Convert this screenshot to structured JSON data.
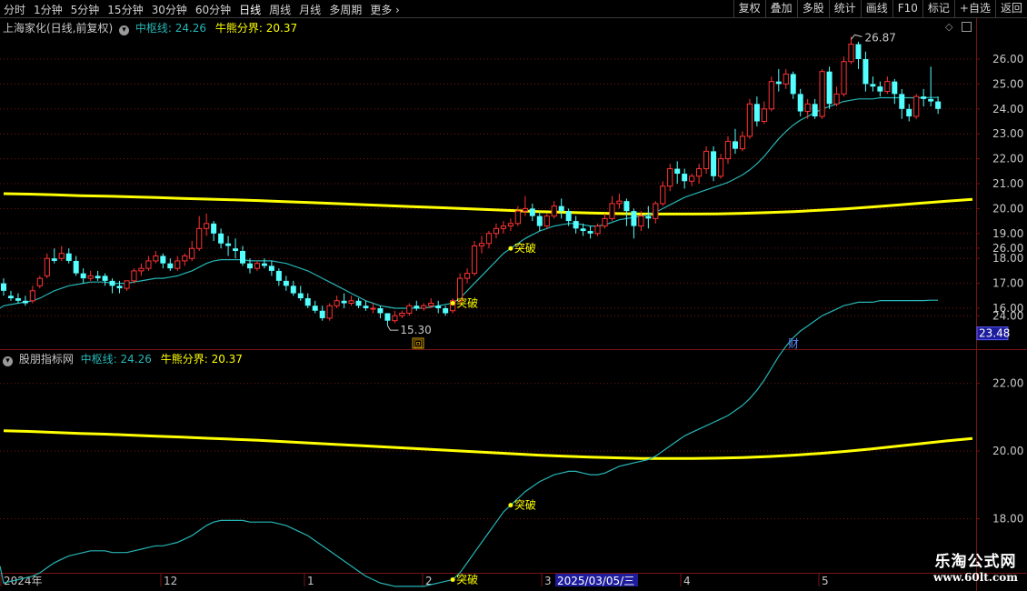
{
  "toolbar": {
    "periods": [
      "分时",
      "1分钟",
      "5分钟",
      "15分钟",
      "30分钟",
      "60分钟",
      "日线",
      "周线",
      "月线",
      "多周期"
    ],
    "active_period": "日线",
    "more": "更多",
    "right_buttons": [
      "复权",
      "叠加",
      "多股",
      "统计",
      "画线",
      "F10",
      "标记",
      "+自选",
      "返回"
    ]
  },
  "main_panel": {
    "title": "上海家化(日线,前复权)",
    "ind1_label": "中枢线: 24.26",
    "ind2_label": "牛熊分界: 20.37",
    "high_label": "26.87",
    "low_label": "15.30",
    "signal_label": "突破",
    "marker_hui": "回",
    "marker_cai": "财"
  },
  "sub_panel": {
    "title": "股朋指标网",
    "ind1_label": "中枢线: 24.26",
    "ind2_label": "牛熊分界: 20.37",
    "current_value": "23.48",
    "signal_label": "突破"
  },
  "time_axis": {
    "labels": [
      "2024年",
      "12",
      "1",
      "2",
      "3",
      "4",
      "5"
    ],
    "cursor_date": "2025/03/05/三"
  },
  "colors": {
    "up": "#ff3232",
    "down": "#54ffff",
    "mid_line": "#27b5b5",
    "bull_bear": "#ffff00",
    "signal": "#ffff00",
    "grid": "#7a1414",
    "axis_text": "#c8c8c8"
  },
  "watermark": {
    "line1": "乐淘公式网",
    "line2": "www.60lt.com"
  },
  "chart_data": {
    "type": "candlestick",
    "main_y_ticks": [
      16.0,
      17.0,
      18.0,
      19.0,
      20.0,
      21.0,
      22.0,
      23.0,
      24.0,
      25.0,
      26.0
    ],
    "sub_y_ticks": [
      18.0,
      20.0,
      22.0,
      24.0,
      26.0
    ],
    "main_ylim": [
      15.0,
      27.3
    ],
    "sub_ylim": [
      16.3,
      28.2
    ],
    "candles": [
      [
        17.0,
        17.2,
        16.7,
        16.5
      ],
      [
        16.5,
        16.7,
        16.4,
        16.3
      ],
      [
        16.4,
        16.6,
        16.3,
        16.2
      ],
      [
        16.3,
        16.5,
        16.2,
        16.1
      ],
      [
        16.3,
        16.9,
        16.7,
        16.2
      ],
      [
        16.9,
        17.3,
        17.2,
        16.8
      ],
      [
        17.3,
        18.2,
        18.0,
        17.2
      ],
      [
        18.0,
        18.4,
        17.9,
        17.8
      ],
      [
        18.0,
        18.5,
        18.2,
        17.9
      ],
      [
        18.2,
        18.4,
        17.9,
        17.8
      ],
      [
        17.9,
        18.1,
        17.4,
        17.3
      ],
      [
        17.4,
        17.6,
        17.2,
        17.0
      ],
      [
        17.2,
        17.5,
        17.3,
        17.1
      ],
      [
        17.3,
        17.5,
        17.2,
        17.1
      ],
      [
        17.3,
        17.4,
        17.1,
        16.9
      ],
      [
        17.1,
        17.2,
        16.9,
        16.6
      ],
      [
        16.9,
        17.1,
        16.8,
        16.6
      ],
      [
        16.8,
        17.0,
        17.1,
        16.7
      ],
      [
        17.1,
        17.6,
        17.5,
        17.0
      ],
      [
        17.5,
        17.8,
        17.6,
        17.3
      ],
      [
        17.6,
        18.1,
        17.9,
        17.5
      ],
      [
        17.9,
        18.3,
        18.1,
        17.8
      ],
      [
        18.1,
        18.2,
        17.8,
        17.6
      ],
      [
        17.8,
        18.0,
        17.6,
        17.5
      ],
      [
        17.6,
        18.1,
        17.9,
        17.5
      ],
      [
        17.9,
        18.2,
        18.1,
        17.7
      ],
      [
        18.0,
        18.7,
        18.4,
        17.9
      ],
      [
        18.4,
        19.7,
        19.2,
        18.3
      ],
      [
        19.2,
        19.8,
        19.4,
        18.9
      ],
      [
        19.4,
        19.5,
        19.0,
        18.7
      ],
      [
        19.0,
        19.2,
        18.6,
        18.4
      ],
      [
        18.6,
        18.9,
        18.5,
        18.1
      ],
      [
        18.4,
        18.8,
        18.3,
        18.0
      ],
      [
        18.3,
        18.5,
        17.8,
        17.7
      ],
      [
        17.8,
        18.0,
        17.6,
        17.4
      ],
      [
        17.6,
        17.9,
        17.8,
        17.5
      ],
      [
        17.8,
        18.0,
        17.7,
        17.6
      ],
      [
        17.7,
        17.9,
        17.5,
        17.3
      ],
      [
        17.5,
        17.6,
        17.1,
        16.9
      ],
      [
        17.1,
        17.3,
        16.9,
        16.7
      ],
      [
        16.9,
        17.1,
        16.6,
        16.5
      ],
      [
        16.6,
        16.9,
        16.4,
        16.3
      ],
      [
        16.4,
        16.6,
        16.1,
        16.0
      ],
      [
        16.1,
        16.3,
        15.9,
        15.8
      ],
      [
        15.9,
        16.1,
        15.6,
        15.5
      ],
      [
        15.6,
        16.2,
        16.1,
        15.5
      ],
      [
        16.1,
        16.5,
        16.3,
        16.0
      ],
      [
        16.3,
        16.6,
        16.2,
        16.0
      ],
      [
        16.2,
        16.5,
        16.3,
        16.1
      ],
      [
        16.3,
        16.4,
        16.1,
        16.0
      ],
      [
        16.1,
        16.3,
        16.0,
        15.9
      ],
      [
        16.0,
        16.2,
        16.0,
        15.8
      ],
      [
        16.0,
        16.1,
        15.8,
        15.6
      ],
      [
        15.8,
        15.8,
        15.5,
        15.3
      ],
      [
        15.5,
        15.9,
        15.7,
        15.4
      ],
      [
        15.7,
        15.9,
        15.8,
        15.6
      ],
      [
        15.8,
        16.2,
        16.1,
        15.7
      ],
      [
        16.1,
        16.3,
        16.0,
        15.9
      ],
      [
        16.0,
        16.2,
        16.1,
        15.9
      ],
      [
        16.1,
        16.4,
        16.2,
        16.0
      ],
      [
        16.1,
        16.3,
        16.0,
        15.8
      ],
      [
        16.0,
        16.1,
        15.8,
        15.7
      ],
      [
        15.9,
        16.4,
        16.3,
        15.8
      ],
      [
        16.3,
        17.4,
        17.2,
        16.2
      ],
      [
        17.2,
        17.6,
        17.4,
        17.0
      ],
      [
        17.4,
        18.7,
        18.5,
        17.3
      ],
      [
        18.5,
        18.9,
        18.6,
        18.2
      ],
      [
        18.6,
        19.1,
        19.0,
        18.4
      ],
      [
        19.0,
        19.4,
        19.2,
        18.8
      ],
      [
        19.2,
        19.5,
        19.3,
        19.0
      ],
      [
        19.3,
        19.6,
        19.4,
        19.1
      ],
      [
        19.4,
        20.1,
        19.9,
        19.3
      ],
      [
        19.9,
        20.5,
        20.0,
        19.7
      ],
      [
        20.0,
        20.2,
        19.7,
        19.5
      ],
      [
        19.7,
        19.9,
        19.3,
        19.1
      ],
      [
        19.3,
        19.8,
        19.7,
        19.2
      ],
      [
        19.7,
        20.3,
        20.1,
        19.6
      ],
      [
        20.1,
        20.4,
        19.9,
        19.6
      ],
      [
        19.9,
        20.0,
        19.5,
        19.3
      ],
      [
        19.5,
        19.7,
        19.2,
        19.0
      ],
      [
        19.2,
        19.4,
        19.1,
        18.9
      ],
      [
        19.1,
        19.3,
        19.0,
        18.8
      ],
      [
        19.0,
        19.4,
        19.3,
        18.9
      ],
      [
        19.3,
        19.8,
        19.6,
        19.2
      ],
      [
        19.6,
        20.5,
        20.2,
        19.5
      ],
      [
        20.2,
        20.6,
        20.3,
        20.0
      ],
      [
        20.3,
        20.4,
        19.9,
        19.3
      ],
      [
        19.9,
        20.0,
        19.3,
        18.8
      ],
      [
        19.3,
        19.9,
        19.7,
        19.1
      ],
      [
        19.7,
        20.1,
        19.6,
        19.2
      ],
      [
        19.6,
        20.3,
        20.2,
        19.4
      ],
      [
        20.2,
        21.1,
        20.9,
        20.1
      ],
      [
        20.9,
        21.8,
        21.6,
        20.7
      ],
      [
        21.6,
        21.9,
        21.4,
        21.0
      ],
      [
        21.4,
        21.6,
        21.1,
        20.8
      ],
      [
        21.1,
        21.4,
        21.3,
        20.9
      ],
      [
        21.3,
        21.8,
        21.6,
        21.0
      ],
      [
        21.6,
        22.5,
        22.3,
        21.4
      ],
      [
        22.3,
        22.5,
        21.3,
        21.1
      ],
      [
        21.3,
        22.2,
        22.0,
        21.2
      ],
      [
        22.0,
        22.9,
        22.7,
        21.8
      ],
      [
        22.7,
        23.2,
        22.4,
        22.2
      ],
      [
        22.4,
        23.1,
        22.9,
        22.3
      ],
      [
        22.9,
        24.4,
        24.2,
        22.8
      ],
      [
        24.2,
        24.5,
        23.5,
        23.3
      ],
      [
        23.5,
        24.3,
        24.0,
        23.4
      ],
      [
        24.0,
        25.3,
        25.1,
        23.9
      ],
      [
        25.1,
        25.6,
        25.0,
        24.7
      ],
      [
        25.0,
        25.6,
        25.4,
        24.8
      ],
      [
        25.4,
        25.5,
        24.6,
        24.4
      ],
      [
        24.6,
        24.8,
        23.9,
        23.7
      ],
      [
        23.9,
        24.4,
        24.2,
        23.6
      ],
      [
        24.2,
        24.4,
        23.7,
        23.6
      ],
      [
        23.7,
        25.6,
        25.5,
        23.6
      ],
      [
        25.5,
        25.7,
        24.2,
        24.0
      ],
      [
        24.2,
        24.9,
        24.6,
        24.1
      ],
      [
        24.6,
        26.1,
        25.9,
        24.5
      ],
      [
        25.9,
        26.9,
        26.6,
        25.8
      ],
      [
        26.6,
        26.7,
        26.0,
        25.6
      ],
      [
        26.0,
        26.3,
        25.0,
        24.7
      ],
      [
        25.0,
        25.3,
        24.9,
        24.7
      ],
      [
        24.9,
        25.1,
        24.7,
        24.5
      ],
      [
        24.7,
        25.3,
        25.1,
        24.6
      ],
      [
        25.1,
        25.2,
        24.6,
        24.2
      ],
      [
        24.6,
        24.8,
        24.0,
        23.6
      ],
      [
        24.0,
        24.2,
        23.7,
        23.5
      ],
      [
        23.7,
        24.6,
        24.5,
        23.6
      ],
      [
        24.5,
        24.8,
        24.4,
        24.1
      ],
      [
        24.4,
        25.7,
        24.3,
        24.1
      ],
      [
        24.3,
        24.5,
        24.0,
        23.8
      ]
    ],
    "mid_line": [
      16.1,
      16.15,
      16.2,
      16.25,
      16.3,
      16.4,
      16.55,
      16.7,
      16.8,
      16.9,
      16.95,
      17.0,
      17.05,
      17.05,
      17.05,
      17.0,
      17.0,
      17.0,
      17.05,
      17.1,
      17.15,
      17.2,
      17.2,
      17.25,
      17.3,
      17.4,
      17.5,
      17.65,
      17.8,
      17.9,
      17.95,
      17.95,
      17.95,
      17.95,
      17.9,
      17.9,
      17.9,
      17.9,
      17.85,
      17.8,
      17.7,
      17.6,
      17.5,
      17.35,
      17.2,
      17.05,
      16.9,
      16.75,
      16.6,
      16.45,
      16.3,
      16.2,
      16.1,
      16.05,
      16.0,
      16.0,
      16.0,
      16.0,
      16.0,
      16.05,
      16.1,
      16.15,
      16.2,
      16.4,
      16.7,
      17.0,
      17.3,
      17.6,
      17.9,
      18.2,
      18.4,
      18.6,
      18.8,
      18.95,
      19.1,
      19.2,
      19.3,
      19.35,
      19.4,
      19.4,
      19.35,
      19.3,
      19.3,
      19.35,
      19.45,
      19.55,
      19.6,
      19.65,
      19.7,
      19.75,
      19.85,
      20.0,
      20.15,
      20.3,
      20.45,
      20.55,
      20.65,
      20.75,
      20.85,
      20.95,
      21.05,
      21.2,
      21.35,
      21.55,
      21.8,
      22.1,
      22.45,
      22.8,
      23.1,
      23.35,
      23.55,
      23.7,
      23.85,
      24.0,
      24.1,
      24.2,
      24.3,
      24.35,
      24.4,
      24.4,
      24.4,
      24.45,
      24.45,
      24.45,
      24.45,
      24.45,
      24.45,
      24.45,
      24.46,
      24.46
    ],
    "bull_bear": [
      20.6,
      20.58,
      20.55,
      20.52,
      20.5,
      20.47,
      20.44,
      20.41,
      20.38,
      20.35,
      20.32,
      20.28,
      20.24,
      20.2,
      20.16,
      20.12,
      20.08,
      20.04,
      20.0,
      19.96,
      19.92,
      19.88,
      19.85,
      19.82,
      19.8,
      19.78,
      19.78,
      19.78,
      19.79,
      19.81,
      19.84,
      19.88,
      19.93,
      19.99,
      20.06,
      20.14,
      20.22,
      20.3,
      20.37
    ],
    "bull_bear_count": 39,
    "breakthrough_indices": [
      62,
      70
    ]
  }
}
